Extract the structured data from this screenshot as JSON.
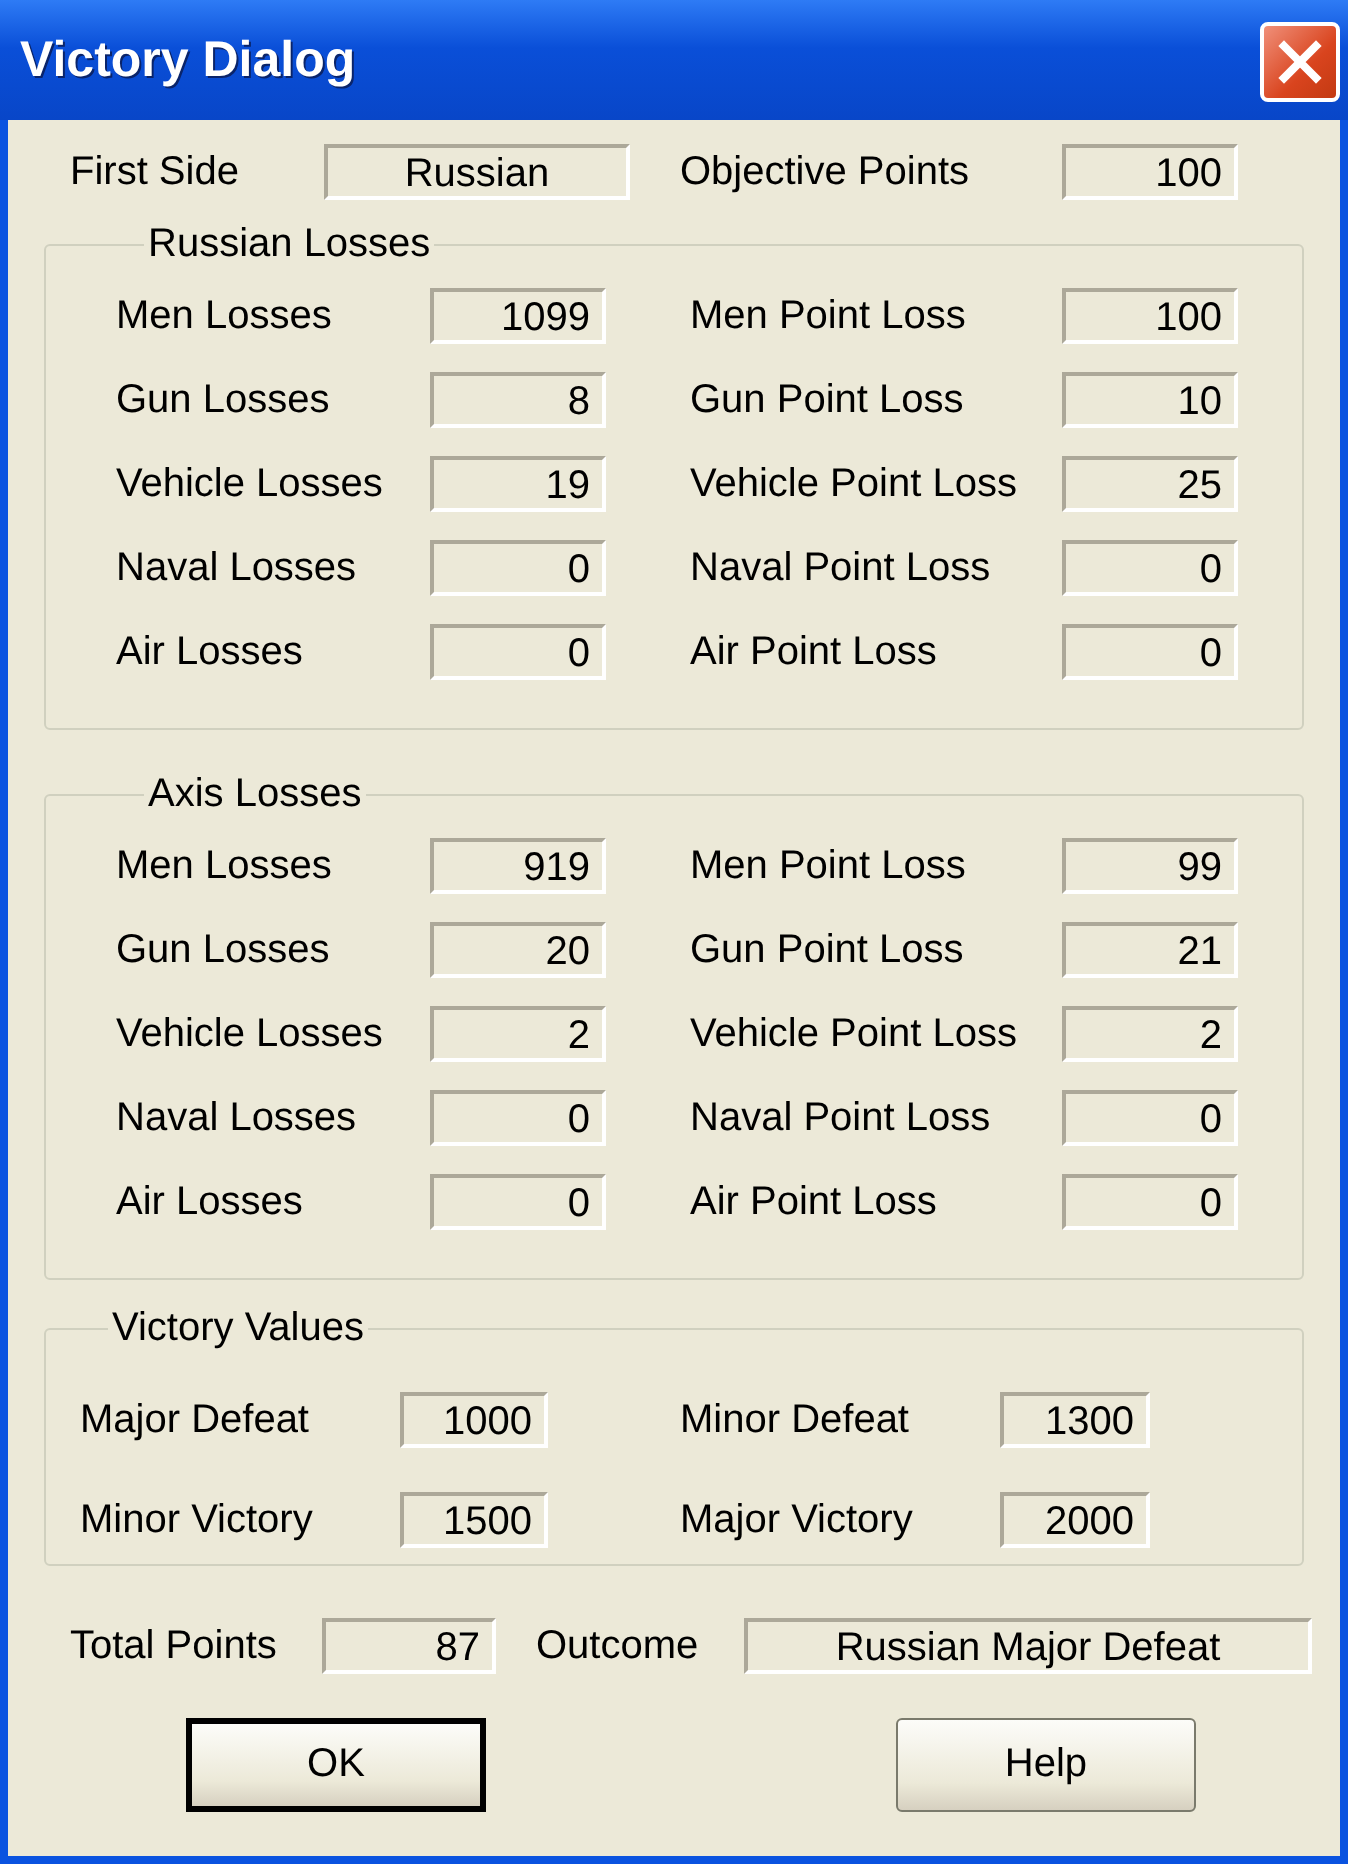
{
  "window": {
    "title": "Victory Dialog"
  },
  "header": [
    {
      "label": "First Side",
      "value": "Russian"
    },
    {
      "label": "Objective Points",
      "value": "100"
    }
  ],
  "groups": [
    {
      "title": "Russian Losses",
      "rows": [
        {
          "label": "Men Losses",
          "value": "1099",
          "point_label": "Men Point Loss",
          "points": "100"
        },
        {
          "label": "Gun Losses",
          "value": "8",
          "point_label": "Gun Point Loss",
          "points": "10"
        },
        {
          "label": "Vehicle Losses",
          "value": "19",
          "point_label": "Vehicle Point Loss",
          "points": "25"
        },
        {
          "label": "Naval Losses",
          "value": "0",
          "point_label": "Naval Point Loss",
          "points": "0"
        },
        {
          "label": "Air Losses",
          "value": "0",
          "point_label": "Air Point Loss",
          "points": "0"
        }
      ]
    },
    {
      "title": "Axis Losses",
      "rows": [
        {
          "label": "Men Losses",
          "value": "919",
          "point_label": "Men Point Loss",
          "points": "99"
        },
        {
          "label": "Gun Losses",
          "value": "20",
          "point_label": "Gun Point Loss",
          "points": "21"
        },
        {
          "label": "Vehicle Losses",
          "value": "2",
          "point_label": "Vehicle Point Loss",
          "points": "2"
        },
        {
          "label": "Naval Losses",
          "value": "0",
          "point_label": "Naval Point Loss",
          "points": "0"
        },
        {
          "label": "Air Losses",
          "value": "0",
          "point_label": "Air Point Loss",
          "points": "0"
        }
      ]
    }
  ],
  "victory_values": {
    "title": "Victory Values",
    "rows": [
      {
        "label": "Major Defeat",
        "value": "1000",
        "point_label": "Minor Defeat",
        "points": "1300"
      },
      {
        "label": "Minor Victory",
        "value": "1500",
        "point_label": "Major Victory",
        "points": "2000"
      }
    ]
  },
  "footer": [
    {
      "label": "Total Points",
      "value": "87"
    },
    {
      "label": "Outcome",
      "value": "Russian Major Defeat"
    }
  ],
  "buttons": [
    {
      "label": "OK",
      "default": true
    },
    {
      "label": "Help",
      "default": false
    }
  ]
}
